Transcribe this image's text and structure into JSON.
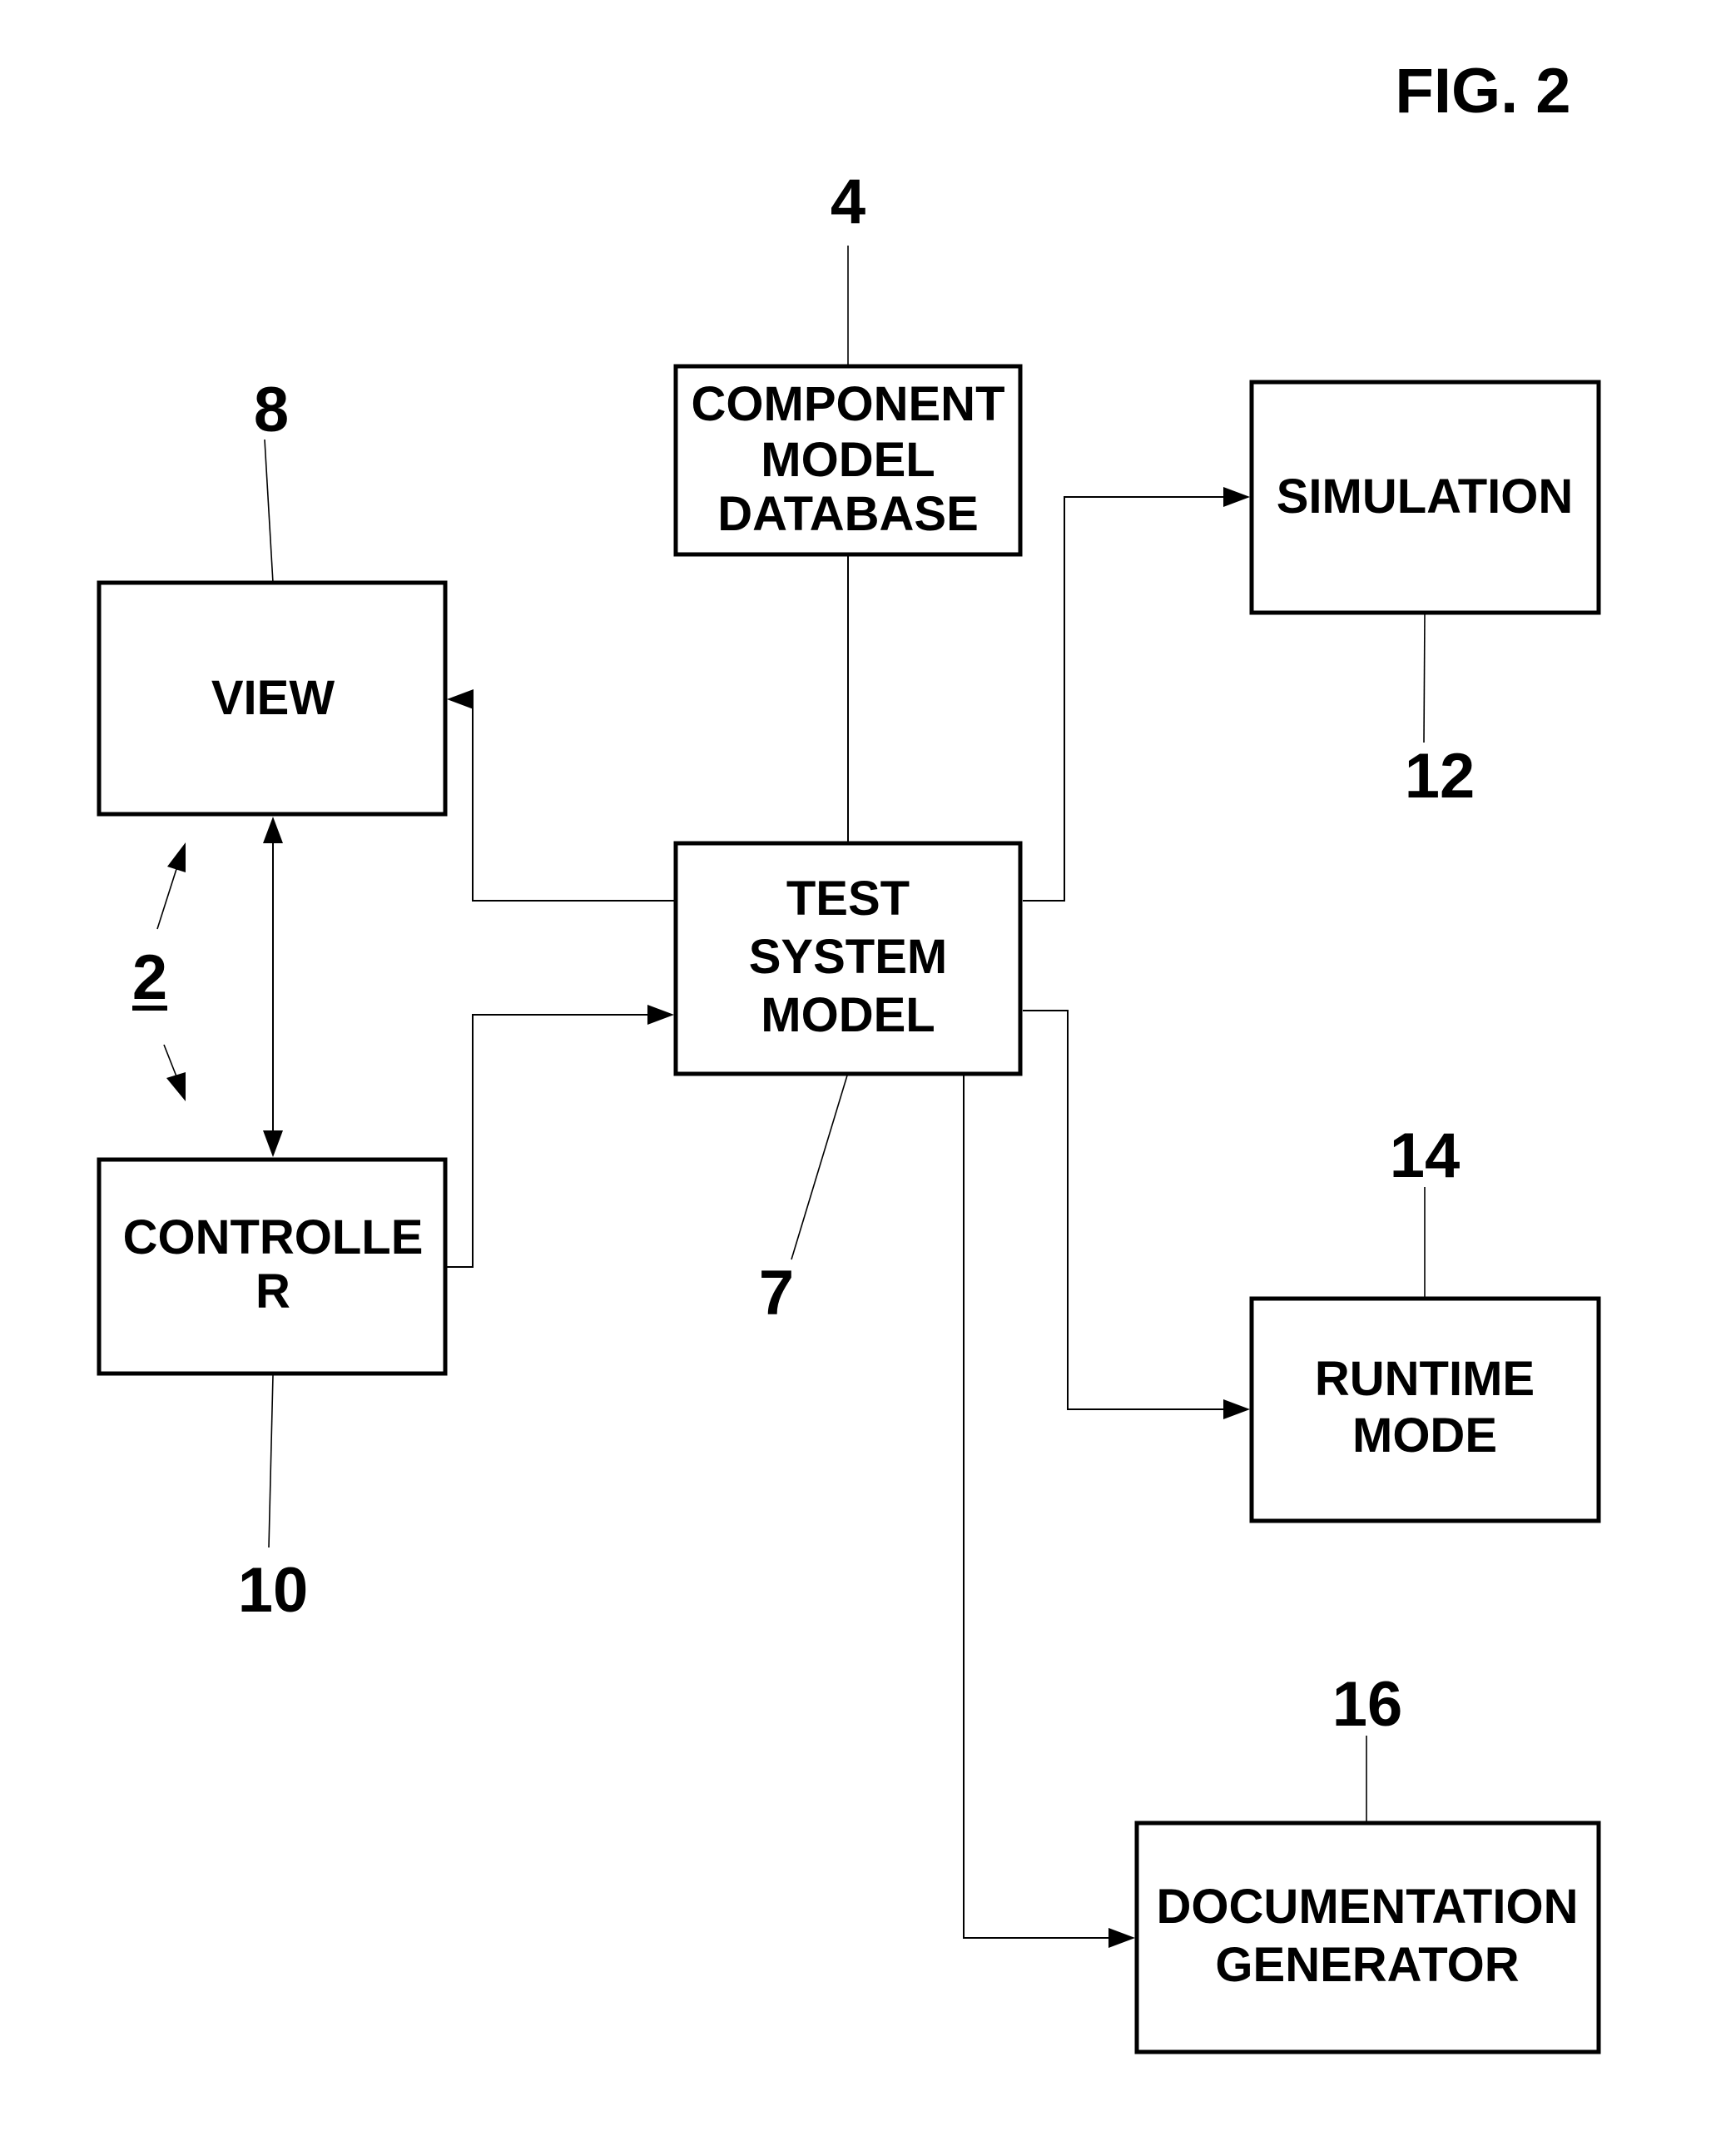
{
  "figure": {
    "title": "FIG. 2",
    "system_ref": {
      "number": "2",
      "underlined": true,
      "refers_to": [
        "view",
        "controller"
      ]
    },
    "blocks": [
      {
        "id": "component_model_database",
        "ref": "4",
        "lines": [
          "COMPONENT",
          "MODEL",
          "DATABASE"
        ]
      },
      {
        "id": "view",
        "ref": "8",
        "lines": [
          "VIEW"
        ]
      },
      {
        "id": "test_system_model",
        "ref": "7",
        "lines": [
          "TEST",
          "SYSTEM",
          "MODEL"
        ]
      },
      {
        "id": "simulation",
        "ref": "12",
        "lines": [
          "SIMULATION"
        ]
      },
      {
        "id": "controller",
        "ref": "10",
        "lines": [
          "CONTROLLE",
          "R"
        ]
      },
      {
        "id": "runtime_mode",
        "ref": "14",
        "lines": [
          "RUNTIME",
          "MODE"
        ]
      },
      {
        "id": "documentation_generator",
        "ref": "16",
        "lines": [
          "DOCUMENTATION",
          "GENERATOR"
        ]
      }
    ],
    "connections": [
      {
        "from": "component_model_database",
        "to": "test_system_model",
        "arrow": "none"
      },
      {
        "from": "test_system_model",
        "to": "view",
        "arrow": "end"
      },
      {
        "from": "view",
        "to": "controller",
        "arrow": "both"
      },
      {
        "from": "controller",
        "to": "test_system_model",
        "arrow": "end"
      },
      {
        "from": "test_system_model",
        "to": "simulation",
        "arrow": "end"
      },
      {
        "from": "test_system_model",
        "to": "runtime_mode",
        "arrow": "end"
      },
      {
        "from": "test_system_model",
        "to": "documentation_generator",
        "arrow": "end"
      }
    ],
    "colors": {
      "ink": "#000000",
      "paper": "#ffffff"
    }
  }
}
